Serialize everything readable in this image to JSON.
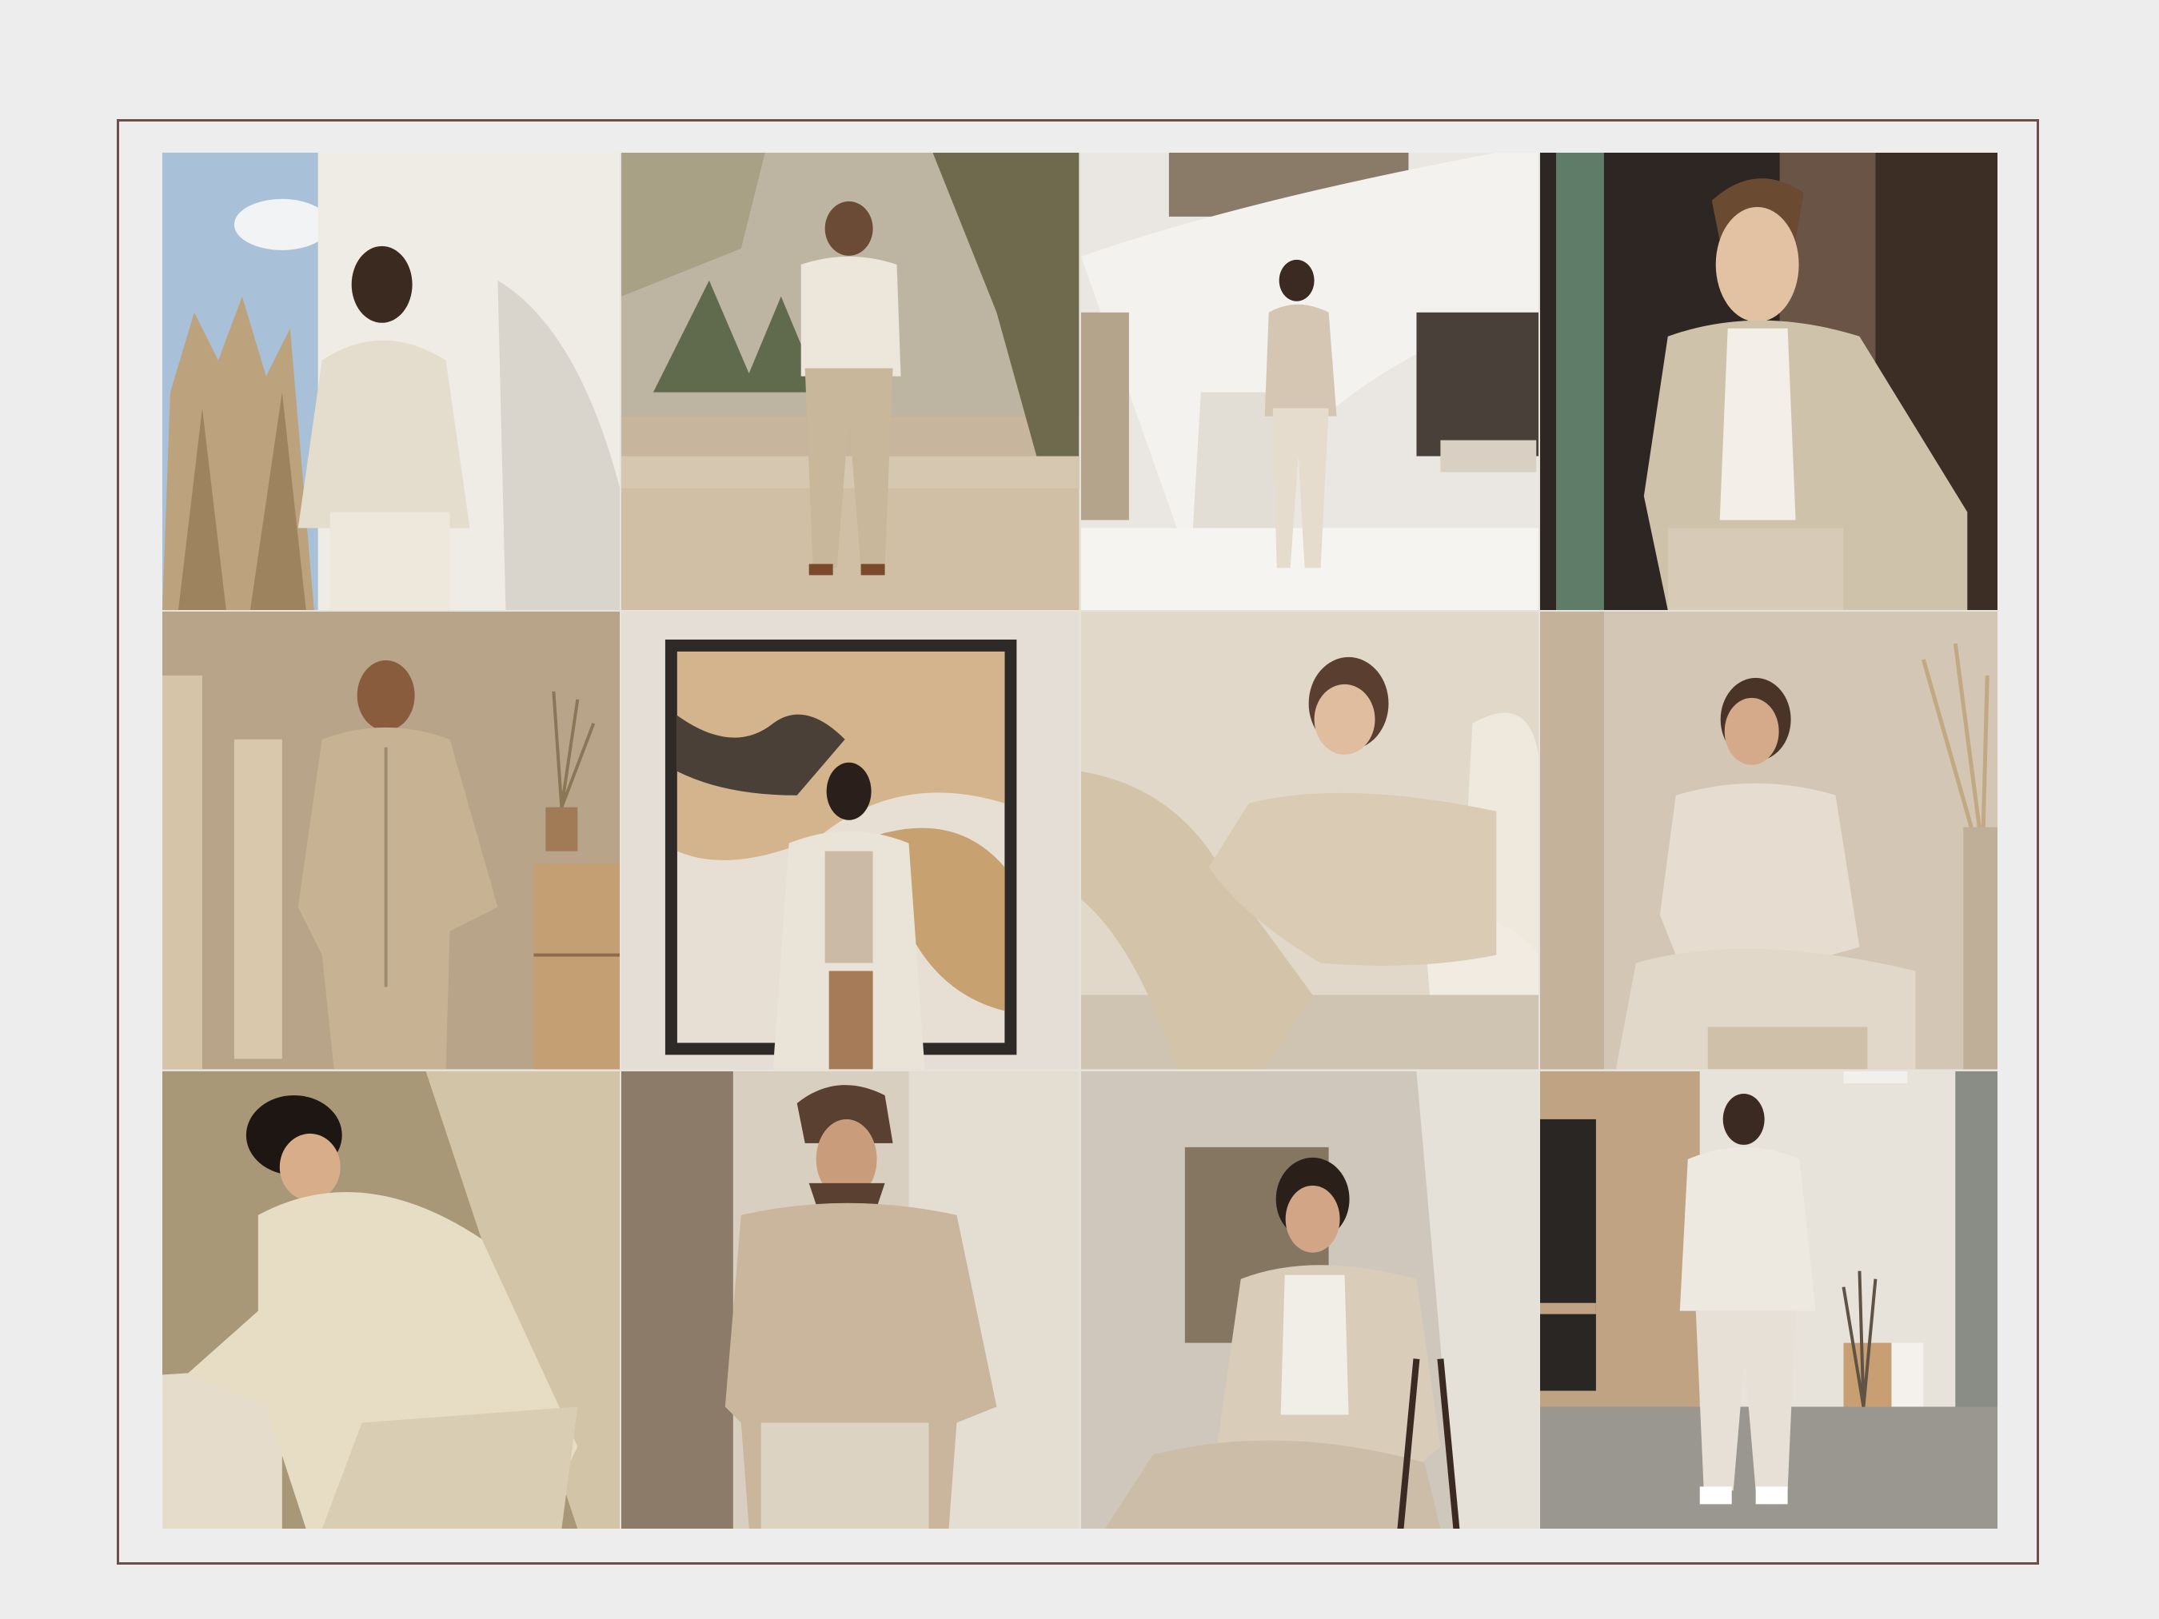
{
  "colors": {
    "page_background": "#ededed",
    "frame_border": "#6e4e4a"
  },
  "gallery": {
    "photos": [
      {
        "id": "photo-1",
        "subject": "man-knit-sweater-against-white-wall",
        "palette": [
          "#eeeae4",
          "#cfc5b3",
          "#e4dccc",
          "#2b1d16"
        ]
      },
      {
        "id": "photo-2",
        "subject": "man-walking-in-garden-courtyard",
        "palette": [
          "#b8a58c",
          "#ece6db",
          "#cbbba3",
          "#6f6a4e"
        ]
      },
      {
        "id": "photo-3",
        "subject": "man-in-suit-by-spiral-staircase",
        "palette": [
          "#e9e6e1",
          "#d4c6b2",
          "#f4f2ee",
          "#9a8874"
        ]
      },
      {
        "id": "photo-4",
        "subject": "man-in-linen-blazer-by-window",
        "palette": [
          "#2d2420",
          "#cfc2aa",
          "#f3efe8",
          "#6d5a4c"
        ]
      },
      {
        "id": "photo-5",
        "subject": "man-in-beige-jacket-with-shadows",
        "palette": [
          "#b9a58b",
          "#c7b393",
          "#d8c6a8",
          "#4a3426"
        ]
      },
      {
        "id": "photo-6",
        "subject": "man-in-coat-before-abstract-painting",
        "palette": [
          "#e8e2da",
          "#c8a170",
          "#e7dfd3",
          "#2d2a28"
        ]
      },
      {
        "id": "photo-7",
        "subject": "man-reclining-in-turtleneck",
        "palette": [
          "#dcd1c2",
          "#d9cbb4",
          "#efe8dd",
          "#5a3e30"
        ]
      },
      {
        "id": "photo-8",
        "subject": "man-seated-in-linen-shirt",
        "palette": [
          "#cdbba6",
          "#e6ddd0",
          "#d8cab5",
          "#4a3428"
        ]
      },
      {
        "id": "photo-9",
        "subject": "man-in-hoodie-seated-in-sunlight",
        "palette": [
          "#a99878",
          "#e7dcc4",
          "#d9cdb3",
          "#1e1612"
        ]
      },
      {
        "id": "photo-10",
        "subject": "man-in-textured-sweater",
        "palette": [
          "#8d7b69",
          "#c9b69d",
          "#ddd2c2",
          "#3a2a22"
        ]
      },
      {
        "id": "photo-11",
        "subject": "man-seated-in-chair-with-blazer",
        "palette": [
          "#cfc7bc",
          "#d9cdb9",
          "#f1eee8",
          "#2b1f19"
        ]
      },
      {
        "id": "photo-12",
        "subject": "man-in-hoodie-set-in-loft",
        "palette": [
          "#bfa383",
          "#e8e3da",
          "#9a9690",
          "#2a2623"
        ]
      }
    ]
  }
}
